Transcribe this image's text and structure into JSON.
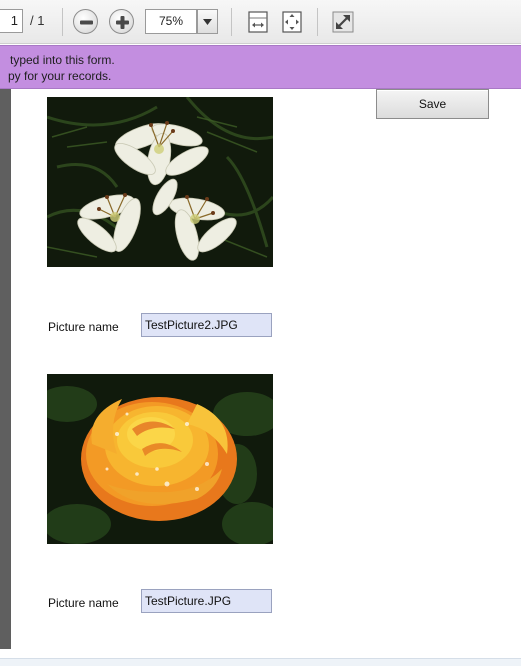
{
  "toolbar": {
    "page_current": "1",
    "page_total": "/ 1",
    "zoom": "75%",
    "icons": [
      "zoom-out-icon",
      "zoom-in-icon",
      "fit-width-icon",
      "fit-page-icon",
      "fullscreen-icon"
    ]
  },
  "banner": {
    "line1": "typed into this form.",
    "line2": "py for your records.",
    "color": "#c38ee0"
  },
  "form": {
    "save_label": "Save",
    "pictures": [
      {
        "label": "Picture name",
        "value": "TestPicture2.JPG",
        "subject": "white lilies"
      },
      {
        "label": "Picture name",
        "value": "TestPicture.JPG",
        "subject": "orange-yellow rose with water droplets"
      }
    ]
  }
}
